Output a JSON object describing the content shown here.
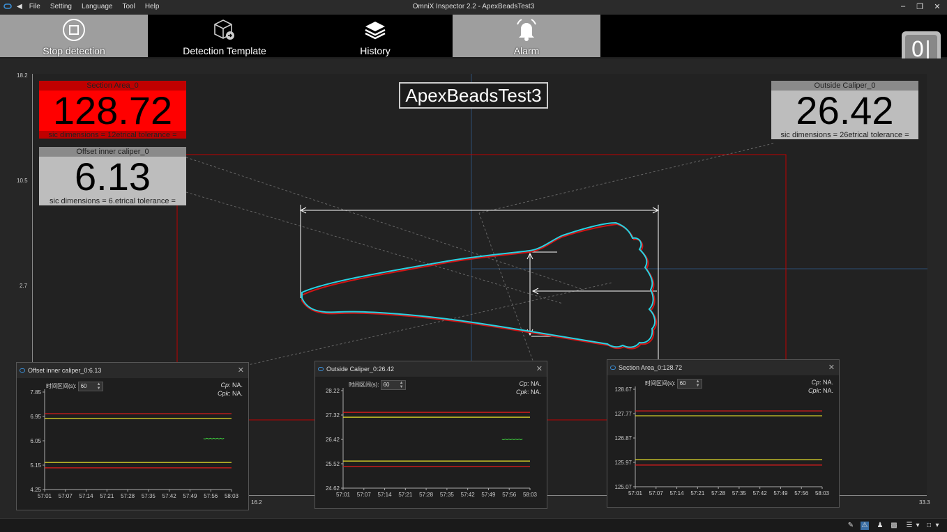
{
  "window": {
    "title": "OmniX Inspector 2.2 - ApexBeadsTest3",
    "menus": [
      "File",
      "Setting",
      "Language",
      "Tool",
      "Help"
    ]
  },
  "toolbar": {
    "buttons": [
      {
        "label": "Stop detection",
        "icon": "stop-icon",
        "active": true
      },
      {
        "label": "Detection Template",
        "icon": "template-icon",
        "active": false
      },
      {
        "label": "History",
        "icon": "layers-icon",
        "active": false
      },
      {
        "label": "Alarm",
        "icon": "bell-icon",
        "active": true
      }
    ],
    "power_label": "0|"
  },
  "main": {
    "project_title": "ApexBeadsTest3",
    "y_ticks": [
      "18.2",
      "10.5",
      "2.7"
    ],
    "x_ticks": [
      "16.2",
      "33.3"
    ],
    "overlays": [
      {
        "header": "Section Area_0",
        "value": "128.72",
        "footer": "sic dimensions = 12\u0001etrical tolerance =",
        "alarm": true
      },
      {
        "header": "Offset inner caliper_0",
        "value": "6.13",
        "footer": "sic dimensions = 6.\u0001etrical tolerance =",
        "alarm": false
      },
      {
        "header": "Outside Caliper_0",
        "value": "26.42",
        "footer": "sic dimensions = 26\u0001etrical tolerance =",
        "alarm": false
      }
    ]
  },
  "trends": [
    {
      "title": "Offset inner caliper_0:6.13",
      "interval_label": "时间区间(s):",
      "interval_value": "60",
      "cp_label": "Cp",
      "cp_value": ": NA.",
      "cpk_label": "Cpk",
      "cpk_value": ": NA.",
      "y_ticks": [
        "7.85",
        "6.95",
        "6.05",
        "5.15",
        "4.25"
      ],
      "x_ticks": [
        "57:01",
        "57:07",
        "57:14",
        "57:21",
        "57:28",
        "57:35",
        "57:42",
        "57:49",
        "57:56",
        "58:03"
      ],
      "usl": 7.05,
      "ucl": 6.87,
      "lcl": 5.25,
      "lsl": 5.05,
      "value": 6.13,
      "ymin": 4.25,
      "ymax": 7.85
    },
    {
      "title": "Outside Caliper_0:26.42",
      "interval_label": "时间区间(s):",
      "interval_value": "60",
      "cp_label": "Cp",
      "cp_value": ": NA.",
      "cpk_label": "Cpk",
      "cpk_value": ": NA.",
      "y_ticks": [
        "28.22",
        "27.32",
        "26.42",
        "25.52",
        "24.62"
      ],
      "x_ticks": [
        "57:01",
        "57:07",
        "57:14",
        "57:21",
        "57:28",
        "57:35",
        "57:42",
        "57:49",
        "57:56",
        "58:03"
      ],
      "usl": 27.42,
      "ucl": 27.24,
      "lcl": 25.62,
      "lsl": 25.42,
      "value": 26.42,
      "ymin": 24.62,
      "ymax": 28.22
    },
    {
      "title": "Section Area_0:128.72",
      "interval_label": "时间区间(s):",
      "interval_value": "60",
      "cp_label": "Cp",
      "cp_value": ": NA.",
      "cpk_label": "Cpk",
      "cpk_value": ": NA.",
      "y_ticks": [
        "128.67",
        "127.77",
        "126.87",
        "125.97",
        "125.07"
      ],
      "x_ticks": [
        "57:01",
        "57:07",
        "57:14",
        "57:21",
        "57:28",
        "57:35",
        "57:42",
        "57:49",
        "57:56",
        "58:03"
      ],
      "usl": 127.87,
      "ucl": 127.69,
      "lcl": 126.07,
      "lsl": 125.87,
      "value": null,
      "ymin": 125.07,
      "ymax": 128.67
    }
  ],
  "colors": {
    "alarm": "#ff0000",
    "accent": "#3a8fd8",
    "profile": "#27d3e3"
  }
}
